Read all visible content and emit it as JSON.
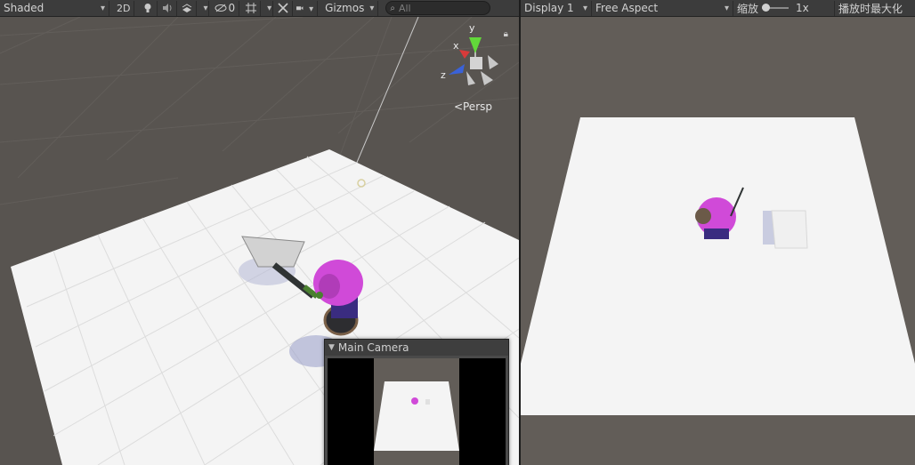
{
  "scene_toolbar": {
    "shading_mode": "Shaded",
    "mode_2d": "2D",
    "light_icon": "lightbulb-icon",
    "audio_icon": "speaker-icon",
    "effects_icon": "effects-icon",
    "hidden_objects_count": "0",
    "grid_icon": "grid-icon",
    "tools_icon": "tools-icon",
    "camera_icon": "camera-icon",
    "gizmos_label": "Gizmos",
    "search_placeholder": "All"
  },
  "game_toolbar": {
    "display": "Display 1",
    "aspect": "Free Aspect",
    "scale_label": "缩放",
    "scale_value": "1x",
    "maximize_label": "播放时最大化"
  },
  "scene_view": {
    "gizmo_axes": {
      "x": "x",
      "y": "y",
      "z": "z"
    },
    "projection_label": "Persp",
    "lock_icon": "lock-icon"
  },
  "camera_preview": {
    "title": "Main Camera"
  },
  "colors": {
    "toolbar_bg": "#3c3c3c",
    "scene_bg": "#585450",
    "game_bg": "#625d58",
    "ground": "#f4f4f4",
    "character_hair": "#d04ad8",
    "axis_x": "#d83a3a",
    "axis_y": "#62d83a",
    "axis_z": "#3a62d8"
  }
}
